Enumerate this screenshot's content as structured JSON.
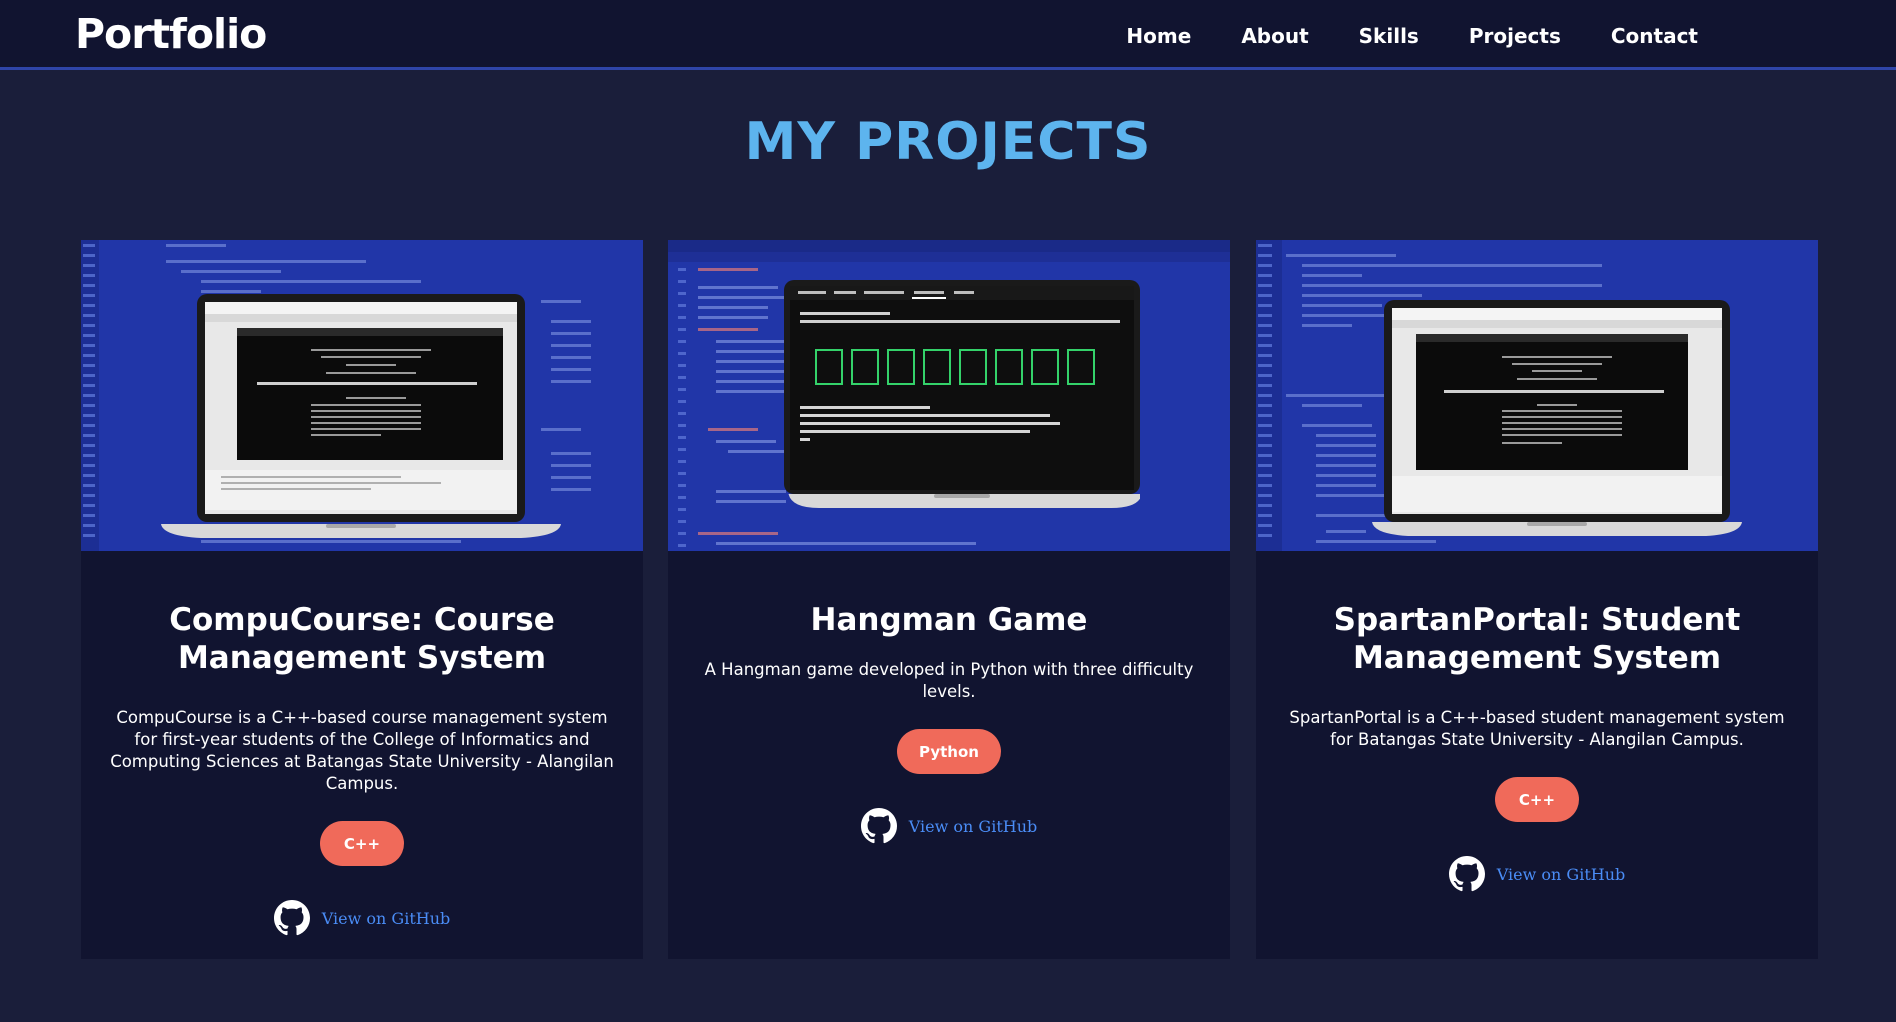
{
  "nav": {
    "brand": "Portfolio",
    "links": [
      "Home",
      "About",
      "Skills",
      "Projects",
      "Contact"
    ]
  },
  "section": {
    "title": "MY PROJECTS"
  },
  "projects": [
    {
      "title": "CompuCourse: Course Management System",
      "description": "CompuCourse is a C++-based course management system for first-year students of the College of Informatics and Computing Sciences at Batangas State University - Alangilan Campus.",
      "tag": "C++",
      "link": "View on GitHub"
    },
    {
      "title": "Hangman Game",
      "description": "A Hangman game developed in Python with three difficulty levels.",
      "tag": "Python",
      "link": "View on GitHub"
    },
    {
      "title": "SpartanPortal: Student Management System",
      "description": "SpartanPortal is a C++-based student management system for Batangas State University - Alangilan Campus.",
      "tag": "C++",
      "link": "View on GitHub"
    }
  ],
  "colors": {
    "background": "#1a1e3a",
    "nav": "#111430",
    "accent_heading": "#5db4ee",
    "tag": "#f06a5a",
    "link": "#4a8cf5",
    "thumb_bg": "#2136a8"
  },
  "icons": {
    "github": "github-icon"
  }
}
